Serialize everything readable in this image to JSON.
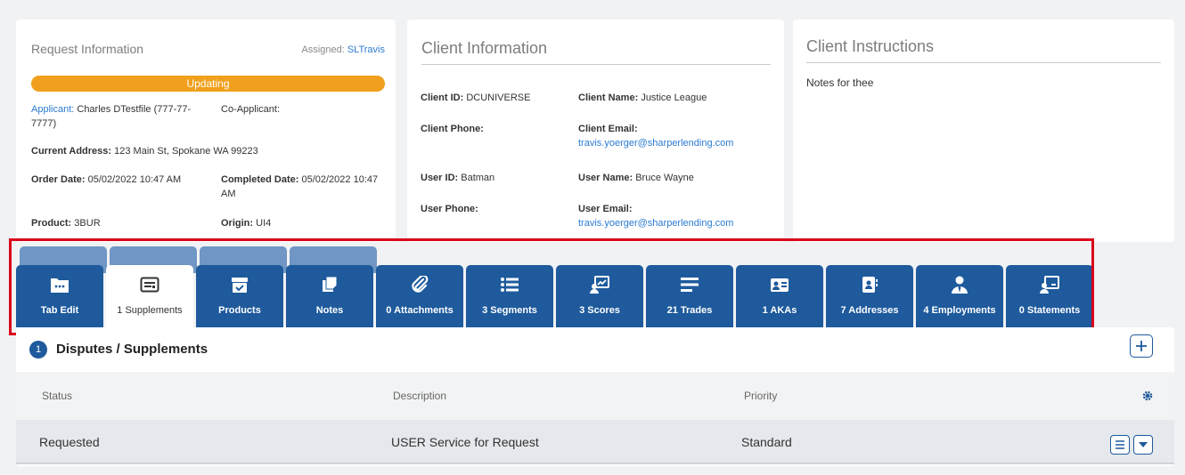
{
  "request": {
    "title": "Request Information",
    "assigned_label": "Assigned:",
    "assigned_value": "SLTravis",
    "status": "Updating",
    "applicant_label": "Applicant:",
    "applicant_value": "Charles DTestfile (777-77-",
    "applicant_value2": "7777)",
    "coapplicant_label": "Co-Applicant:",
    "address_label": "Current Address:",
    "address_value": "123 Main St, Spokane WA 99223",
    "order_label": "Order Date:",
    "order_value": "05/02/2022 10:47 AM",
    "completed_label": "Completed Date:",
    "completed_value": "05/02/2022 10:47",
    "completed_value2": "AM",
    "product_label": "Product:",
    "product_value": "3BUR",
    "origin_label": "Origin:",
    "origin_value": "UI4"
  },
  "client": {
    "title": "Client Information",
    "client_id_label": "Client ID:",
    "client_id_value": "DCUNIVERSE",
    "client_name_label": "Client Name:",
    "client_name_value": "Justice League",
    "client_phone_label": "Client Phone:",
    "client_email_label": "Client Email:",
    "client_email_value": "travis.yoerger@sharperlending.com",
    "user_id_label": "User ID:",
    "user_id_value": "Batman",
    "user_name_label": "User Name:",
    "user_name_value": "Bruce Wayne",
    "user_phone_label": "User Phone:",
    "user_email_label": "User Email:",
    "user_email_value": "travis.yoerger@sharperlending.com"
  },
  "instructions": {
    "title": "Client Instructions",
    "notes": "Notes for thee"
  },
  "tabs": [
    {
      "label": "Tab Edit",
      "icon": "folder-icon"
    },
    {
      "label": "1 Supplements",
      "icon": "id-card-icon",
      "active": true
    },
    {
      "label": "Products",
      "icon": "box-check-icon"
    },
    {
      "label": "Notes",
      "icon": "notes-icon"
    },
    {
      "label": "0 Attachments",
      "icon": "paperclip-icon"
    },
    {
      "label": "3 Segments",
      "icon": "list-icon"
    },
    {
      "label": "3 Scores",
      "icon": "chart-user-icon"
    },
    {
      "label": "21 Trades",
      "icon": "lines-icon"
    },
    {
      "label": "1 AKAs",
      "icon": "id-badge-icon"
    },
    {
      "label": "7 Addresses",
      "icon": "address-book-icon"
    },
    {
      "label": "4 Employments",
      "icon": "user-tie-icon"
    },
    {
      "label": "0 Statements",
      "icon": "presentation-user-icon"
    }
  ],
  "disputes": {
    "count": "1",
    "title": "Disputes / Supplements",
    "columns": [
      "Status",
      "Description",
      "Priority"
    ],
    "rows": [
      {
        "status": "Requested",
        "description": "USER Service for Request",
        "priority": "Standard"
      }
    ]
  },
  "colors": {
    "accent": "#1e5a9c",
    "status_updating": "#f0a01c",
    "highlight": "#d9001b",
    "link": "#2b7bd1"
  }
}
